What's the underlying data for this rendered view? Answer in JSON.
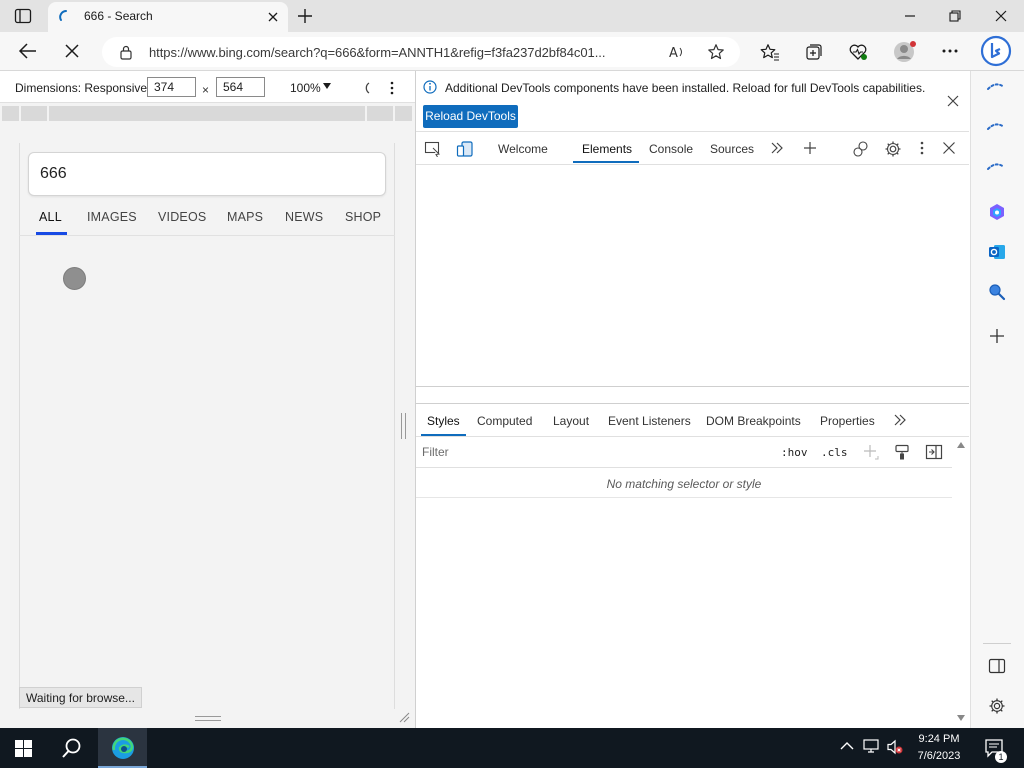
{
  "browser": {
    "tab": {
      "title": "666 - Search"
    },
    "address": {
      "url": "https://www.bing.com/search?q=666&form=ANNTH1&refig=f3fa237d2bf84c01..."
    }
  },
  "emulation": {
    "dimensions_label": "Dimensions: Responsive",
    "width": "374",
    "height": "564",
    "zoom": "100%"
  },
  "page": {
    "query": "666",
    "tabs": [
      "ALL",
      "IMAGES",
      "VIDEOS",
      "MAPS",
      "NEWS",
      "SHOP"
    ],
    "active_tab": "ALL",
    "status": "Waiting for browse..."
  },
  "devtools": {
    "info_message": "Additional DevTools components have been installed. Reload for full DevTools capabilities.",
    "reload_label": "Reload DevTools",
    "tabs": [
      "Welcome",
      "Elements",
      "Console",
      "Sources"
    ],
    "active_tab": "Elements",
    "styles_tabs": [
      "Styles",
      "Computed",
      "Layout",
      "Event Listeners",
      "DOM Breakpoints",
      "Properties"
    ],
    "active_styles_tab": "Styles",
    "filter_placeholder": "Filter",
    "hov": ":hov",
    "cls": ".cls",
    "no_match": "No matching selector or style"
  },
  "taskbar": {
    "time": "9:24 PM",
    "date": "7/6/2023",
    "notification_count": "1"
  },
  "colors": {
    "accent": "#0f6cbd",
    "bing_blue": "#174ae4",
    "taskbar": "#101820"
  }
}
